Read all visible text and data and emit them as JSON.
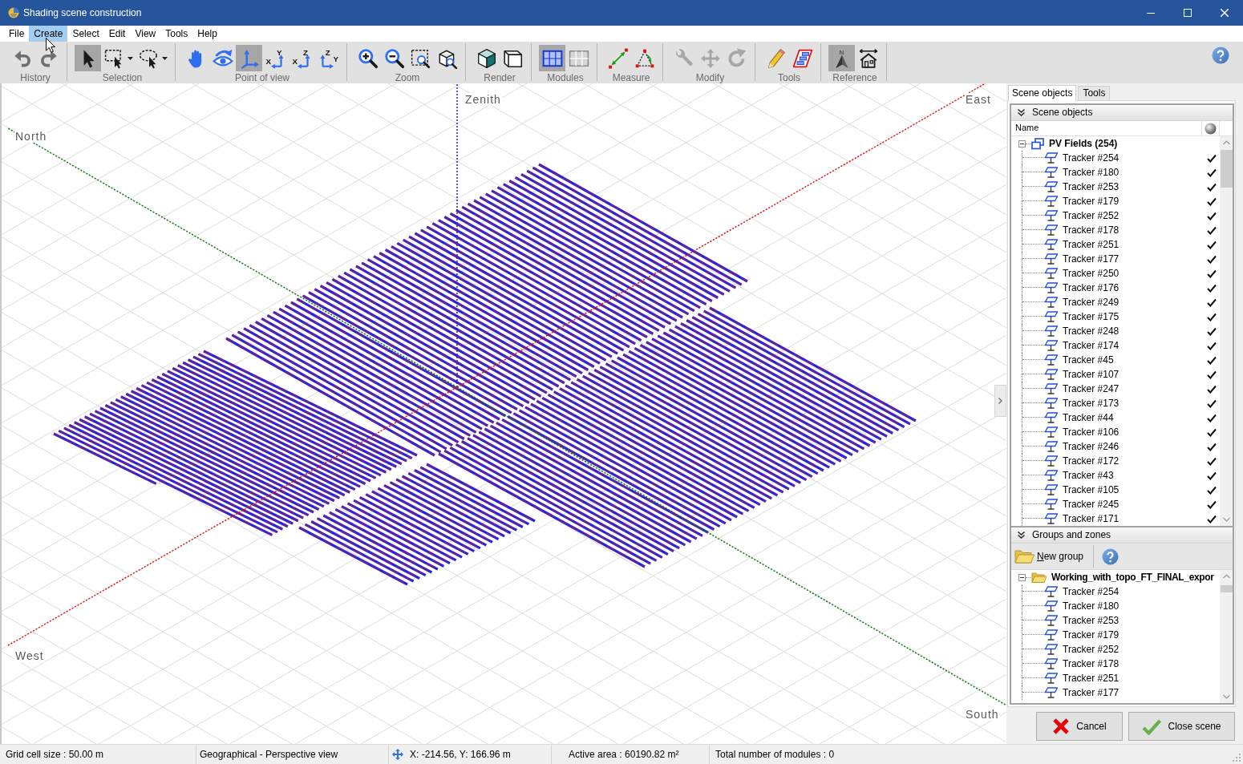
{
  "window": {
    "title": "Shading scene construction"
  },
  "menu": [
    {
      "label": "File",
      "selected": false
    },
    {
      "label": "Create",
      "selected": true
    },
    {
      "label": "Select",
      "selected": false
    },
    {
      "label": "Edit",
      "selected": false
    },
    {
      "label": "View",
      "selected": false
    },
    {
      "label": "Tools",
      "selected": false
    },
    {
      "label": "Help",
      "selected": false
    }
  ],
  "toolbar": {
    "groups": [
      {
        "label": "History",
        "tools": [
          {
            "kind": "undo",
            "selected": false,
            "disabled": false,
            "dropdown": false
          },
          {
            "kind": "redo",
            "selected": false,
            "disabled": false,
            "dropdown": false
          }
        ]
      },
      {
        "label": "Selection",
        "tools": [
          {
            "kind": "pointer",
            "selected": true,
            "disabled": false,
            "dropdown": false
          },
          {
            "kind": "marquee",
            "selected": false,
            "disabled": false,
            "dropdown": true
          },
          {
            "kind": "lasso",
            "selected": false,
            "disabled": false,
            "dropdown": true
          }
        ]
      },
      {
        "label": "Point of view",
        "tools": [
          {
            "kind": "pan",
            "selected": false,
            "disabled": false,
            "dropdown": false
          },
          {
            "kind": "orbit",
            "selected": false,
            "disabled": false,
            "dropdown": false
          },
          {
            "kind": "axes",
            "selected": true,
            "disabled": false,
            "dropdown": false
          },
          {
            "kind": "xy",
            "letters": [
              "X",
              "Y"
            ],
            "selected": false,
            "disabled": false,
            "dropdown": false
          },
          {
            "kind": "xz",
            "letters": [
              "X",
              "Z"
            ],
            "selected": false,
            "disabled": false,
            "dropdown": false
          },
          {
            "kind": "zy",
            "letters": [
              "Z",
              "Y"
            ],
            "selected": false,
            "disabled": false,
            "dropdown": false
          }
        ]
      },
      {
        "label": "Zoom",
        "tools": [
          {
            "kind": "zoomin",
            "selected": false,
            "disabled": false,
            "dropdown": false
          },
          {
            "kind": "zoomout",
            "selected": false,
            "disabled": false,
            "dropdown": false
          },
          {
            "kind": "zoomrect",
            "selected": false,
            "disabled": false,
            "dropdown": false
          },
          {
            "kind": "zoombox",
            "selected": false,
            "disabled": false,
            "dropdown": false
          }
        ]
      },
      {
        "label": "Render",
        "tools": [
          {
            "kind": "solid",
            "selected": false,
            "disabled": false,
            "dropdown": false
          },
          {
            "kind": "wireframe",
            "selected": false,
            "disabled": false,
            "dropdown": false
          }
        ]
      },
      {
        "label": "Modules",
        "tools": [
          {
            "kind": "modules",
            "selected": true,
            "disabled": false,
            "dropdown": false
          },
          {
            "kind": "modulegrid",
            "selected": false,
            "disabled": false,
            "dropdown": false
          }
        ]
      },
      {
        "label": "Measure",
        "tools": [
          {
            "kind": "distance",
            "selected": false,
            "disabled": false,
            "dropdown": false
          },
          {
            "kind": "angle",
            "selected": false,
            "disabled": false,
            "dropdown": false
          }
        ]
      },
      {
        "label": "Modify",
        "tools": [
          {
            "kind": "wrench",
            "selected": false,
            "disabled": true,
            "dropdown": false
          },
          {
            "kind": "move",
            "selected": false,
            "disabled": true,
            "dropdown": false
          },
          {
            "kind": "rotate",
            "selected": false,
            "disabled": true,
            "dropdown": false
          }
        ]
      },
      {
        "label": "Tools",
        "tools": [
          {
            "kind": "pencil",
            "selected": false,
            "disabled": false,
            "dropdown": false
          },
          {
            "kind": "blocks",
            "selected": false,
            "disabled": false,
            "dropdown": false
          }
        ]
      },
      {
        "label": "Reference",
        "tools": [
          {
            "kind": "north",
            "letters": [
              "N"
            ],
            "selected": true,
            "disabled": false,
            "dropdown": false
          },
          {
            "kind": "house",
            "selected": false,
            "disabled": false,
            "dropdown": false
          }
        ]
      }
    ]
  },
  "viewport": {
    "axes": [
      {
        "kind": "zenith",
        "label": "Zenith"
      },
      {
        "kind": "north",
        "label": "North"
      },
      {
        "kind": "east",
        "label": "East"
      },
      {
        "kind": "west",
        "label": "West"
      },
      {
        "kind": "south",
        "label": "South"
      }
    ]
  },
  "panel": {
    "tabs": [
      {
        "label": "Scene objects",
        "selected": true
      },
      {
        "label": "Tools",
        "selected": false
      }
    ],
    "scene_objects": {
      "title": "Scene objects",
      "column": "Name",
      "root": {
        "kind": "field",
        "label": "PV Fields (254)",
        "expanded": true,
        "children": [
          {
            "label": "Tracker #254",
            "checked": true
          },
          {
            "label": "Tracker #180",
            "checked": true
          },
          {
            "label": "Tracker #253",
            "checked": true
          },
          {
            "label": "Tracker #179",
            "checked": true
          },
          {
            "label": "Tracker #252",
            "checked": true
          },
          {
            "label": "Tracker #178",
            "checked": true
          },
          {
            "label": "Tracker #251",
            "checked": true
          },
          {
            "label": "Tracker #177",
            "checked": true
          },
          {
            "label": "Tracker #250",
            "checked": true
          },
          {
            "label": "Tracker #176",
            "checked": true
          },
          {
            "label": "Tracker #249",
            "checked": true
          },
          {
            "label": "Tracker #175",
            "checked": true
          },
          {
            "label": "Tracker #248",
            "checked": true
          },
          {
            "label": "Tracker #174",
            "checked": true
          },
          {
            "label": "Tracker #45",
            "checked": true
          },
          {
            "label": "Tracker #107",
            "checked": true
          },
          {
            "label": "Tracker #247",
            "checked": true
          },
          {
            "label": "Tracker #173",
            "checked": true
          },
          {
            "label": "Tracker #44",
            "checked": true
          },
          {
            "label": "Tracker #106",
            "checked": true
          },
          {
            "label": "Tracker #246",
            "checked": true
          },
          {
            "label": "Tracker #172",
            "checked": true
          },
          {
            "label": "Tracker #43",
            "checked": true
          },
          {
            "label": "Tracker #105",
            "checked": true
          },
          {
            "label": "Tracker #245",
            "checked": true
          },
          {
            "label": "Tracker #171",
            "checked": true
          }
        ]
      }
    },
    "groups_and_zones": {
      "title": "Groups and zones",
      "new_group": "New group",
      "root": {
        "kind": "folder",
        "label": "Working_with_topo_FT_FINAL_expor",
        "expanded": true,
        "children": [
          {
            "label": "Tracker #254"
          },
          {
            "label": "Tracker #180"
          },
          {
            "label": "Tracker #253"
          },
          {
            "label": "Tracker #179"
          },
          {
            "label": "Tracker #252"
          },
          {
            "label": "Tracker #178"
          },
          {
            "label": "Tracker #251"
          },
          {
            "label": "Tracker #177"
          }
        ]
      }
    },
    "buttons": [
      {
        "kind": "cancel",
        "label": "Cancel"
      },
      {
        "kind": "close",
        "label": "Close scene"
      }
    ]
  },
  "status_bar": [
    {
      "kind": "text",
      "text": "Grid cell size : 50.00 m"
    },
    {
      "kind": "text",
      "text": "Geographical - Perspective view"
    },
    {
      "kind": "position",
      "text": "X: -214.56, Y: 166.96 m"
    },
    {
      "kind": "text",
      "text": "Active area : 60190.82 m²"
    },
    {
      "kind": "text",
      "text": "Total number of modules : 0"
    }
  ]
}
